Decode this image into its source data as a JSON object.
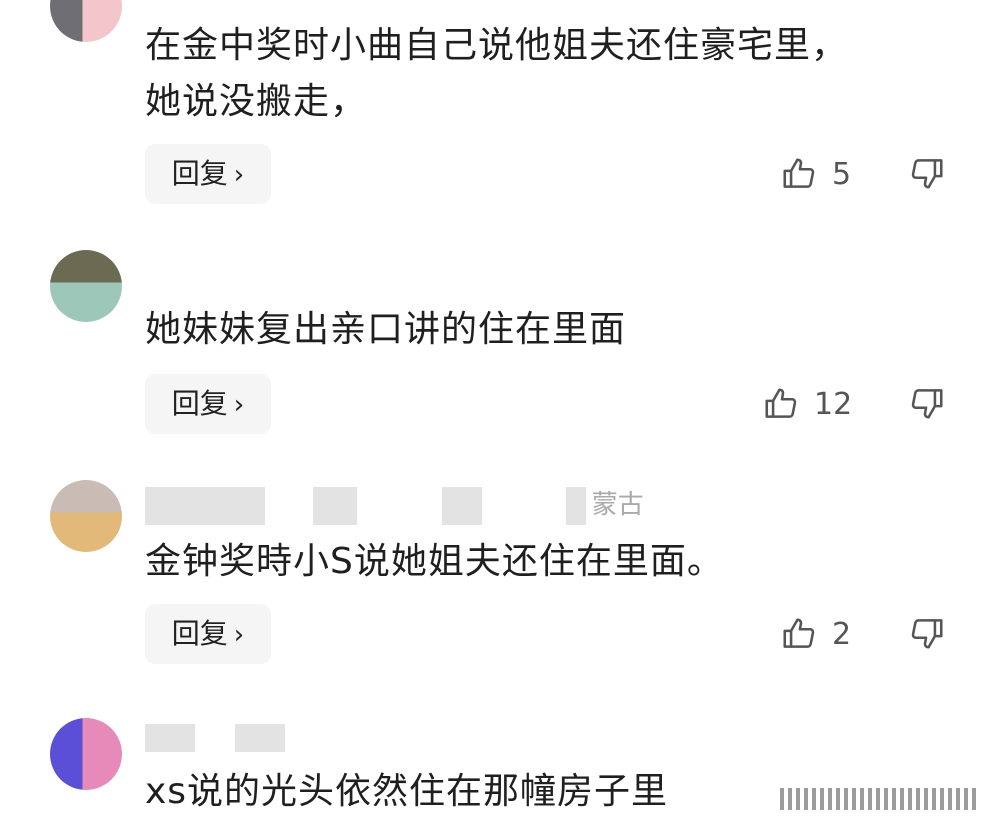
{
  "comments": [
    {
      "meta": "",
      "text": "在金中奖时小曲自己说他姐夫还住豪宅里，\n她说没搬走，",
      "reply_label": "回复",
      "likes": "5"
    },
    {
      "meta": "",
      "text": "她妹妹复出亲口讲的住在里面",
      "reply_label": "回复",
      "likes": "12"
    },
    {
      "meta": "蒙古",
      "text": "金钟奖時小S说她姐夫还住在里面。",
      "reply_label": "回复",
      "likes": "2"
    },
    {
      "meta": "",
      "text": "xs说的光头依然住在那幢房子里",
      "reply_label": "",
      "likes": ""
    }
  ],
  "colors": {
    "text": "#1f1f1f",
    "meta": "#b5b5b5",
    "reply_bg": "#f5f5f5",
    "icon": "#555555"
  },
  "icons": {
    "like": "thumbs-up-icon",
    "dislike": "thumbs-down-icon",
    "reply_arrow": "chevron-right-icon"
  }
}
